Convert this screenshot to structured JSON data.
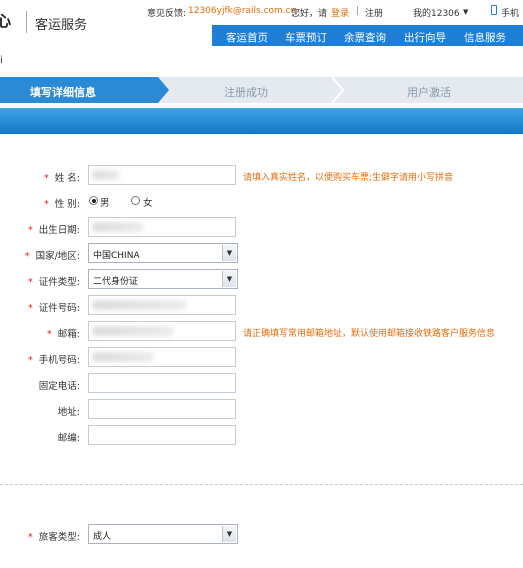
{
  "header": {
    "logo_fragment": "心",
    "site_name": "客运服务",
    "feedback_label": "意见反馈:",
    "feedback_email": "12306yjfk@rails.com.cn",
    "greeting": "您好，请",
    "login": "登录",
    "separator": "|",
    "register": "注册",
    "my_account": "我的12306",
    "mobile_icon_label": "手机",
    "caret": "▼"
  },
  "nav": [
    "客运首页",
    "车票预订",
    "余票查询",
    "出行向导",
    "信息服务"
  ],
  "breadcrumb_fragment": "i",
  "steps": [
    "填写详细信息",
    "注册成功",
    "用户激活"
  ],
  "form": {
    "name": {
      "label": "姓 名:",
      "hint": "请填入真实姓名，以便购买车票;生僻字请用小写拼音"
    },
    "gender": {
      "label": "性 别:",
      "options": [
        "男",
        "女"
      ],
      "selected": "男"
    },
    "birthdate": {
      "label": "出生日期:"
    },
    "country": {
      "label": "国家/地区:",
      "value": "中国CHINA"
    },
    "id_type": {
      "label": "证件类型:",
      "value": "二代身份证"
    },
    "id_number": {
      "label": "证件号码:"
    },
    "email": {
      "label": "邮箱:",
      "hint": "请正确填写常用邮箱地址，默认使用邮箱接收铁路客户服务信息"
    },
    "mobile": {
      "label": "手机号码:"
    },
    "phone": {
      "label": "固定电话:"
    },
    "address": {
      "label": "地址:"
    },
    "postcode": {
      "label": "邮编:"
    },
    "passenger_type": {
      "label": "旅客类型:",
      "value": "成人"
    }
  },
  "colors": {
    "nav_blue": "#1e7fd4",
    "accent_orange": "#e46c0a",
    "required_red": "#e02020"
  }
}
